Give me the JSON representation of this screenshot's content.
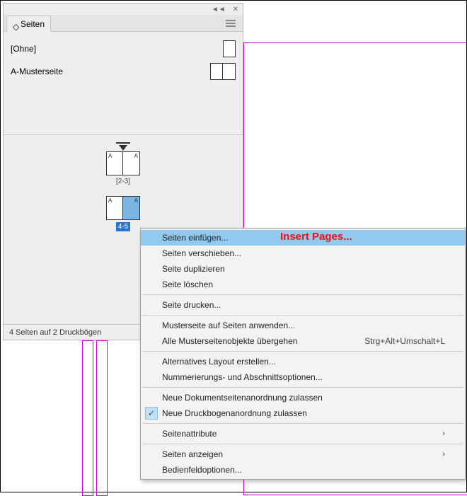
{
  "panel": {
    "tab_label": "Seiten",
    "masters": [
      {
        "label": "[Ohne]",
        "type": "single"
      },
      {
        "label": "A-Musterseite",
        "type": "double"
      }
    ],
    "spreads": [
      {
        "label": "[2-3]",
        "pages": [
          "A",
          "A"
        ],
        "selected": false
      },
      {
        "label": "4-5",
        "pages": [
          "A",
          "A"
        ],
        "selected": true,
        "sel_page_index": 1
      }
    ],
    "status": "4 Seiten auf 2 Druckbögen"
  },
  "context_menu": {
    "items": [
      {
        "label": "Seiten einfügen...",
        "highlight": true
      },
      {
        "label": "Seiten verschieben..."
      },
      {
        "label": "Seite duplizieren"
      },
      {
        "label": "Seite löschen"
      },
      {
        "sep": true
      },
      {
        "label": "Seite drucken..."
      },
      {
        "sep": true
      },
      {
        "label": "Musterseite auf Seiten anwenden..."
      },
      {
        "label": "Alle Musterseitenobjekte übergehen",
        "shortcut": "Strg+Alt+Umschalt+L"
      },
      {
        "sep": true
      },
      {
        "label": "Alternatives Layout erstellen..."
      },
      {
        "label": "Nummerierungs- und Abschnittsoptionen..."
      },
      {
        "sep": true
      },
      {
        "label": "Neue Dokumentseitenanordnung zulassen"
      },
      {
        "label": "Neue Druckbogenanordnung zulassen",
        "checked": true
      },
      {
        "sep": true
      },
      {
        "label": "Seitenattribute",
        "submenu": true
      },
      {
        "sep": true
      },
      {
        "label": "Seiten anzeigen",
        "submenu": true
      },
      {
        "label": "Bedienfeldoptionen..."
      }
    ]
  },
  "annotation": {
    "insert_pages": "Insert Pages..."
  },
  "glyphs": {
    "collapse": "◄◄",
    "close": "✕",
    "updown": "◇",
    "check": "✓",
    "chevron": "›"
  }
}
